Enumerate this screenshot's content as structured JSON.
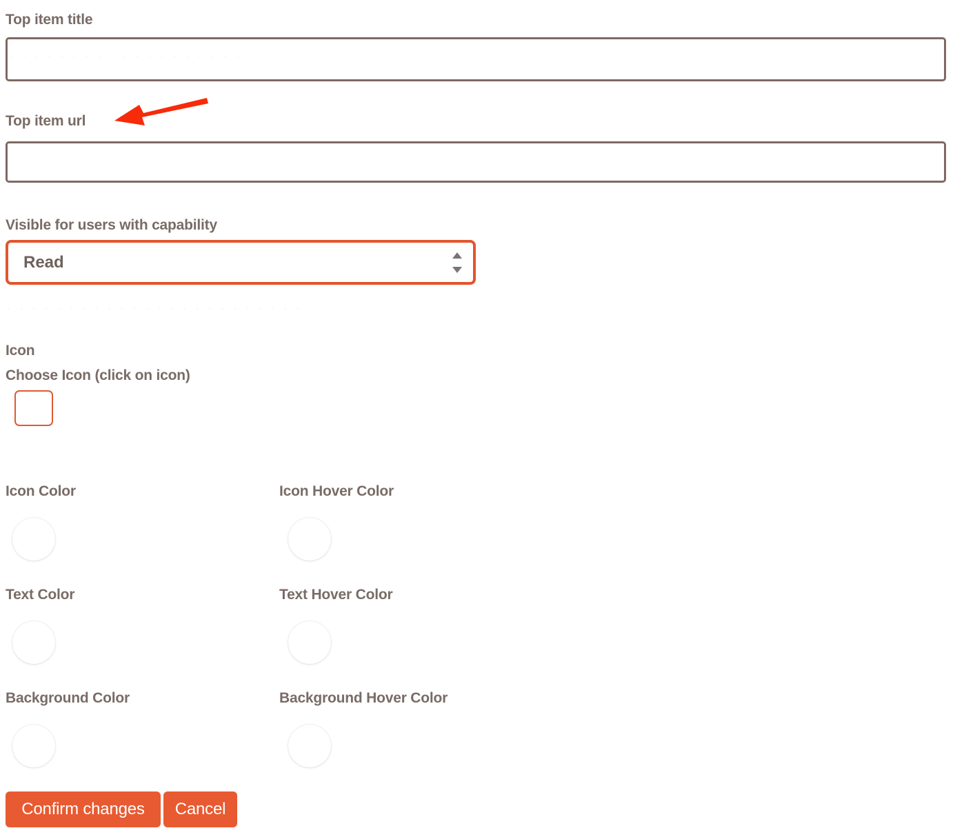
{
  "form": {
    "fields": {
      "top_item_title": {
        "label": "Top item title",
        "value": "",
        "placeholder": ""
      },
      "top_item_url": {
        "label": "Top item url",
        "value": "",
        "placeholder": ""
      },
      "visible_capability": {
        "label": "Visible for users with capability",
        "selected": "Read",
        "options": [
          "Read"
        ]
      }
    },
    "icon_section": {
      "heading": "Icon",
      "choose_label": "Choose Icon (click on icon)",
      "chosen_icon": ""
    },
    "colors": [
      {
        "label": "Icon Color",
        "value": ""
      },
      {
        "label": "Icon Hover Color",
        "value": ""
      },
      {
        "label": "Text Color",
        "value": ""
      },
      {
        "label": "Text Hover Color",
        "value": ""
      },
      {
        "label": "Background Color",
        "value": ""
      },
      {
        "label": "Background Hover Color",
        "value": ""
      }
    ],
    "actions": {
      "confirm_label": "Confirm changes",
      "cancel_label": "Cancel"
    }
  },
  "theme": {
    "accent": "#e85a31",
    "select_border": "#e2552d",
    "input_border": "#7d6a63",
    "label_text": "#796b66",
    "annotation": "#f72a09",
    "page_background": "#ffffff"
  },
  "annotation": {
    "type": "arrow",
    "points_to": "Top item url"
  }
}
